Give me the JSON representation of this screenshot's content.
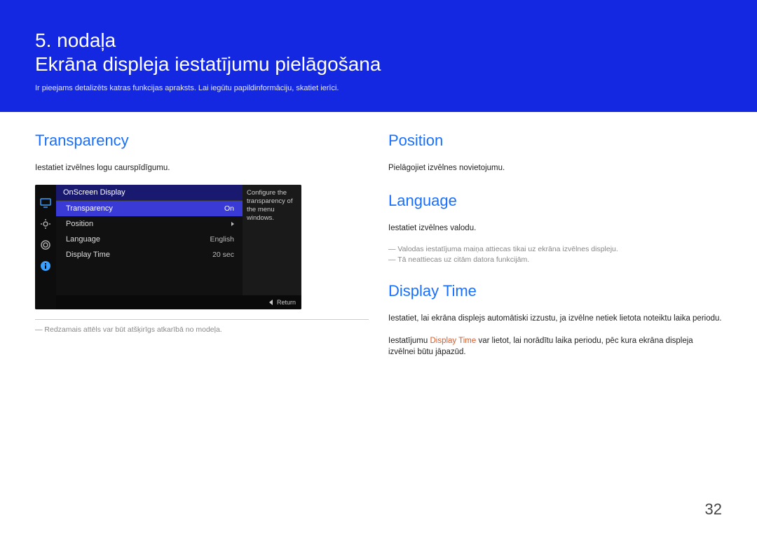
{
  "banner": {
    "chapter": "5. nodaļa",
    "title": "Ekrāna displeja iestatījumu pielāgošana",
    "subtitle": "Ir pieejams detalizēts katras funkcijas apraksts. Lai iegūtu papildinformāciju, skatiet ierīci."
  },
  "left": {
    "transparency": {
      "heading": "Transparency",
      "desc": "Iestatiet izvēlnes logu caurspīdīgumu."
    },
    "osd": {
      "header": "OnScreen Display",
      "rows": [
        {
          "label": "Transparency",
          "value": "On",
          "selected": true
        },
        {
          "label": "Position",
          "value": "",
          "arrow": true
        },
        {
          "label": "Language",
          "value": "English"
        },
        {
          "label": "Display Time",
          "value": "20 sec"
        }
      ],
      "tip": "Configure the transparency of the menu windows.",
      "return": "Return"
    },
    "footnote": "Redzamais attēls var būt atšķirīgs atkarībā no modeļa."
  },
  "right": {
    "position": {
      "heading": "Position",
      "desc": "Pielāgojiet izvēlnes novietojumu."
    },
    "language": {
      "heading": "Language",
      "desc": "Iestatiet izvēlnes valodu.",
      "note1": "Valodas iestatījuma maiņa attiecas tikai uz ekrāna izvēlnes displeju.",
      "note2": "Tā neattiecas uz citām datora funkcijām."
    },
    "display_time": {
      "heading": "Display Time",
      "desc1": "Iestatiet, lai ekrāna displejs automātiski izzustu, ja izvēlne netiek lietota noteiktu laika periodu.",
      "desc2a": "Iestatījumu ",
      "desc2red": "Display Time",
      "desc2b": " var lietot, lai norādītu laika periodu, pēc kura ekrāna displeja izvēlnei būtu jāpazūd."
    }
  },
  "page_number": "32"
}
